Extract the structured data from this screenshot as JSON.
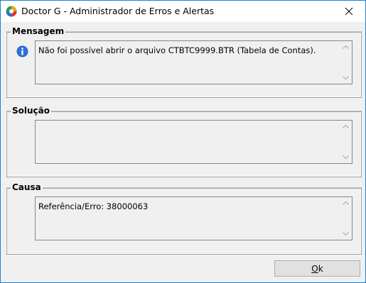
{
  "window": {
    "title": "Doctor G - Administrador de Erros e Alertas"
  },
  "sections": {
    "mensagem": {
      "label": "Mensagem",
      "text": "Não foi possível abrir o arquivo CTBTC9999.BTR (Tabela de Contas)."
    },
    "solucao": {
      "label": "Solução",
      "text": ""
    },
    "causa": {
      "label": "Causa",
      "text": "Referência/Erro: 38000063"
    }
  },
  "buttons": {
    "ok_mnemonic": "O",
    "ok_rest": "k"
  },
  "icons": {
    "app": "doctor-g-app-icon",
    "info": "info-icon",
    "close": "close-icon"
  },
  "colors": {
    "window_border": "#1883d7",
    "info_blue": "#1f5fbf"
  }
}
